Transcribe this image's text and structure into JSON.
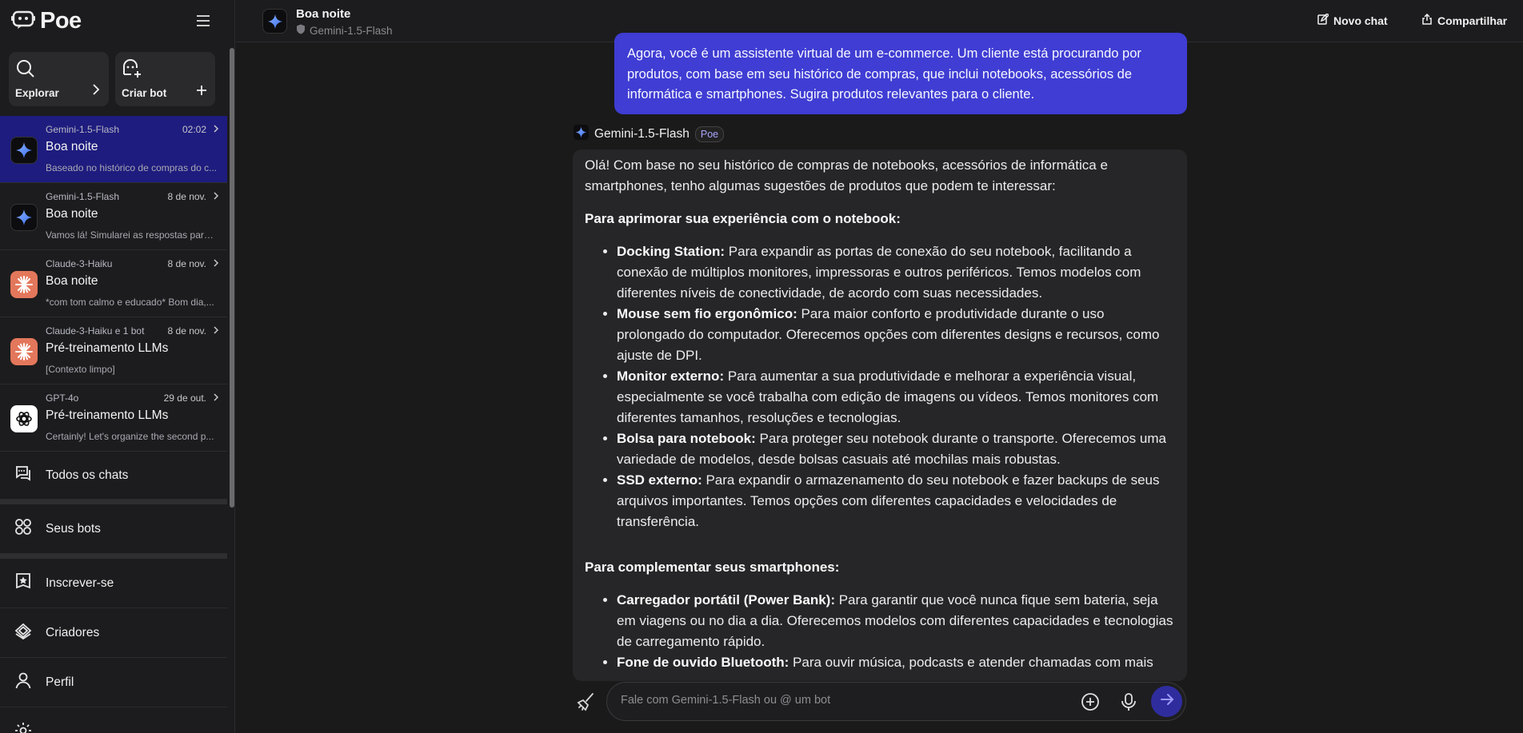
{
  "sidebar": {
    "logo": "Poe",
    "explore_label": "Explorar",
    "create_bot_label": "Criar bot",
    "chats": [
      {
        "bot": "Gemini-1.5-Flash",
        "time": "02:02",
        "title": "Boa noite",
        "preview": "Baseado no histórico de compras do c...",
        "avatar": "gemini-icon"
      },
      {
        "bot": "Gemini-1.5-Flash",
        "time": "8 de nov.",
        "title": "Boa noite",
        "preview": "Vamos lá! Simularei as respostas para ...",
        "avatar": "gemini-icon"
      },
      {
        "bot": "Claude-3-Haiku",
        "time": "8 de nov.",
        "title": "Boa noite",
        "preview": "*com tom calmo e educado* Bom dia,...",
        "avatar": "claude-icon"
      },
      {
        "bot": "Claude-3-Haiku e 1 bot",
        "time": "8 de nov.",
        "title": "Pré-treinamento LLMs",
        "preview": "[Contexto limpo]",
        "avatar": "claude-icon"
      },
      {
        "bot": "GPT-4o",
        "time": "29 de out.",
        "title": "Pré-treinamento LLMs",
        "preview": "Certainly! Let's organize the second p...",
        "avatar": "openai-icon"
      }
    ],
    "nav": {
      "all_chats": "Todos os chats",
      "your_bots": "Seus bots",
      "subscribe": "Inscrever-se",
      "creators": "Criadores",
      "profile": "Perfil"
    }
  },
  "header": {
    "title": "Boa noite",
    "bot": "Gemini-1.5-Flash",
    "new_chat": "Novo chat",
    "share": "Compartilhar"
  },
  "conversation": {
    "user_message": "Agora, você é um assistente virtual de um e-commerce. Um cliente está procurando por produtos, com base em seu histórico de compras, que inclui notebooks, acessórios de informática e smartphones. Sugira produtos relevantes para o cliente.",
    "bot_name": "Gemini-1.5-Flash",
    "bot_badge": "Poe",
    "intro": "Olá! Com base no seu histórico de compras de notebooks, acessórios de informática e smartphones, tenho algumas sugestões de produtos que podem te interessar:",
    "section1_title": "Para aprimorar sua experiência com o notebook:",
    "section1_items": [
      {
        "name": "Docking Station:",
        "text": " Para expandir as portas de conexão do seu notebook, facilitando a conexão de múltiplos monitores, impressoras e outros periféricos. Temos modelos com diferentes níveis de conectividade, de acordo com suas necessidades."
      },
      {
        "name": "Mouse sem fio ergonômico:",
        "text": " Para maior conforto e produtividade durante o uso prolongado do computador. Oferecemos opções com diferentes designs e recursos, como ajuste de DPI."
      },
      {
        "name": "Monitor externo:",
        "text": " Para aumentar a sua produtividade e melhorar a experiência visual, especialmente se você trabalha com edição de imagens ou vídeos. Temos monitores com diferentes tamanhos, resoluções e tecnologias."
      },
      {
        "name": "Bolsa para notebook:",
        "text": " Para proteger seu notebook durante o transporte. Oferecemos uma variedade de modelos, desde bolsas casuais até mochilas mais robustas."
      },
      {
        "name": "SSD externo:",
        "text": " Para expandir o armazenamento do seu notebook e fazer backups de seus arquivos importantes. Temos opções com diferentes capacidades e velocidades de transferência."
      }
    ],
    "section2_title": "Para complementar seus smartphones:",
    "section2_items": [
      {
        "name": "Carregador portátil (Power Bank):",
        "text": " Para garantir que você nunca fique sem bateria, seja em viagens ou no dia a dia. Oferecemos modelos com diferentes capacidades e tecnologias de carregamento rápido."
      },
      {
        "name": "Fone de ouvido Bluetooth:",
        "text": " Para ouvir música, podcasts e atender chamadas com mais"
      }
    ]
  },
  "composer": {
    "placeholder": "Fale com Gemini-1.5-Flash ou @ um bot"
  }
}
